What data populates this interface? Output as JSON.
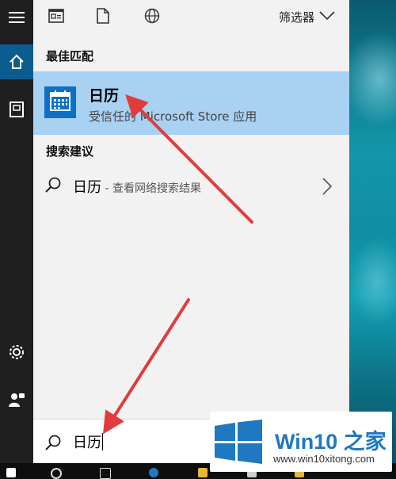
{
  "toolbar": {
    "icons": [
      "document-list-icon",
      "blank-page-icon",
      "globe-icon"
    ],
    "filter_label": "筛选器"
  },
  "sections": {
    "best_match_title": "最佳匹配",
    "suggestions_title": "搜索建议"
  },
  "best_match": {
    "name": "日历",
    "subtitle": "受信任的 Microsoft Store 应用",
    "tile_color": "#0e6fc6",
    "highlight_color": "#a9d1f2"
  },
  "suggestion": {
    "text": "日历",
    "extra": " - 查看网络搜索结果"
  },
  "search": {
    "value": "日历"
  },
  "rail": {
    "icons": [
      "hamburger-menu-icon",
      "home-icon",
      "notebook-icon",
      "settings-gear-icon",
      "feedback-person-icon"
    ]
  },
  "watermark": {
    "title": "Win10 之家",
    "url": "www.win10xitong.com"
  },
  "colors": {
    "rail_bg": "#1f1f1f",
    "rail_active": "#0b5d8f",
    "panel_bg": "#f2f2f2",
    "arrow": "#e23b3b"
  }
}
